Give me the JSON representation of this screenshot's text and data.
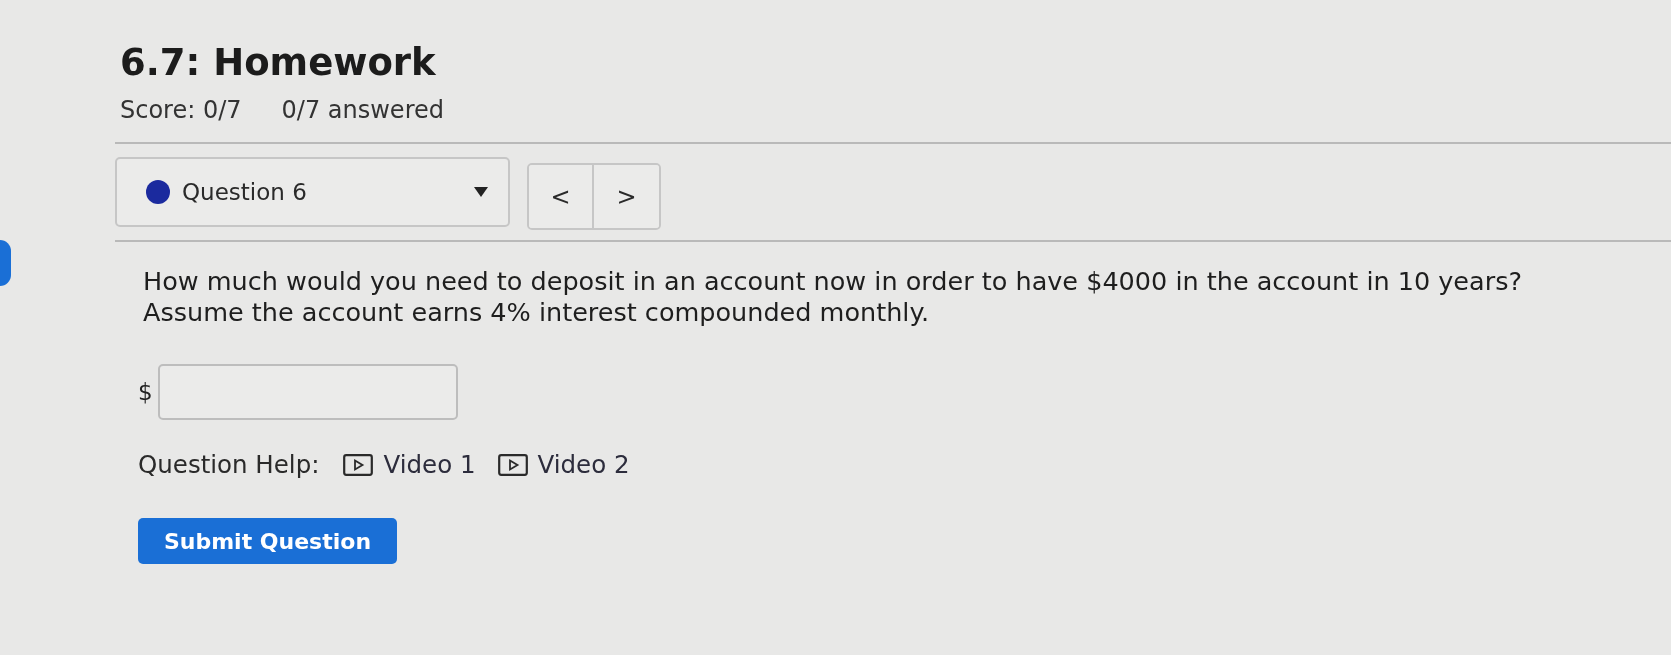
{
  "header": {
    "title": "6.7: Homework",
    "score": "Score: 0/7",
    "answered": "0/7 answered"
  },
  "question_nav": {
    "label": "Question 6",
    "prev": "<",
    "next": ">"
  },
  "question": {
    "text": "How much would you need to deposit in an account now in order to have $4000 in the account in 10 years?\nAssume the account earns 4% interest compounded monthly.",
    "answer_prefix": "$"
  },
  "help": {
    "label": "Question Help:",
    "videos": [
      "Video 1",
      "Video 2"
    ]
  },
  "submit": "Submit Question"
}
